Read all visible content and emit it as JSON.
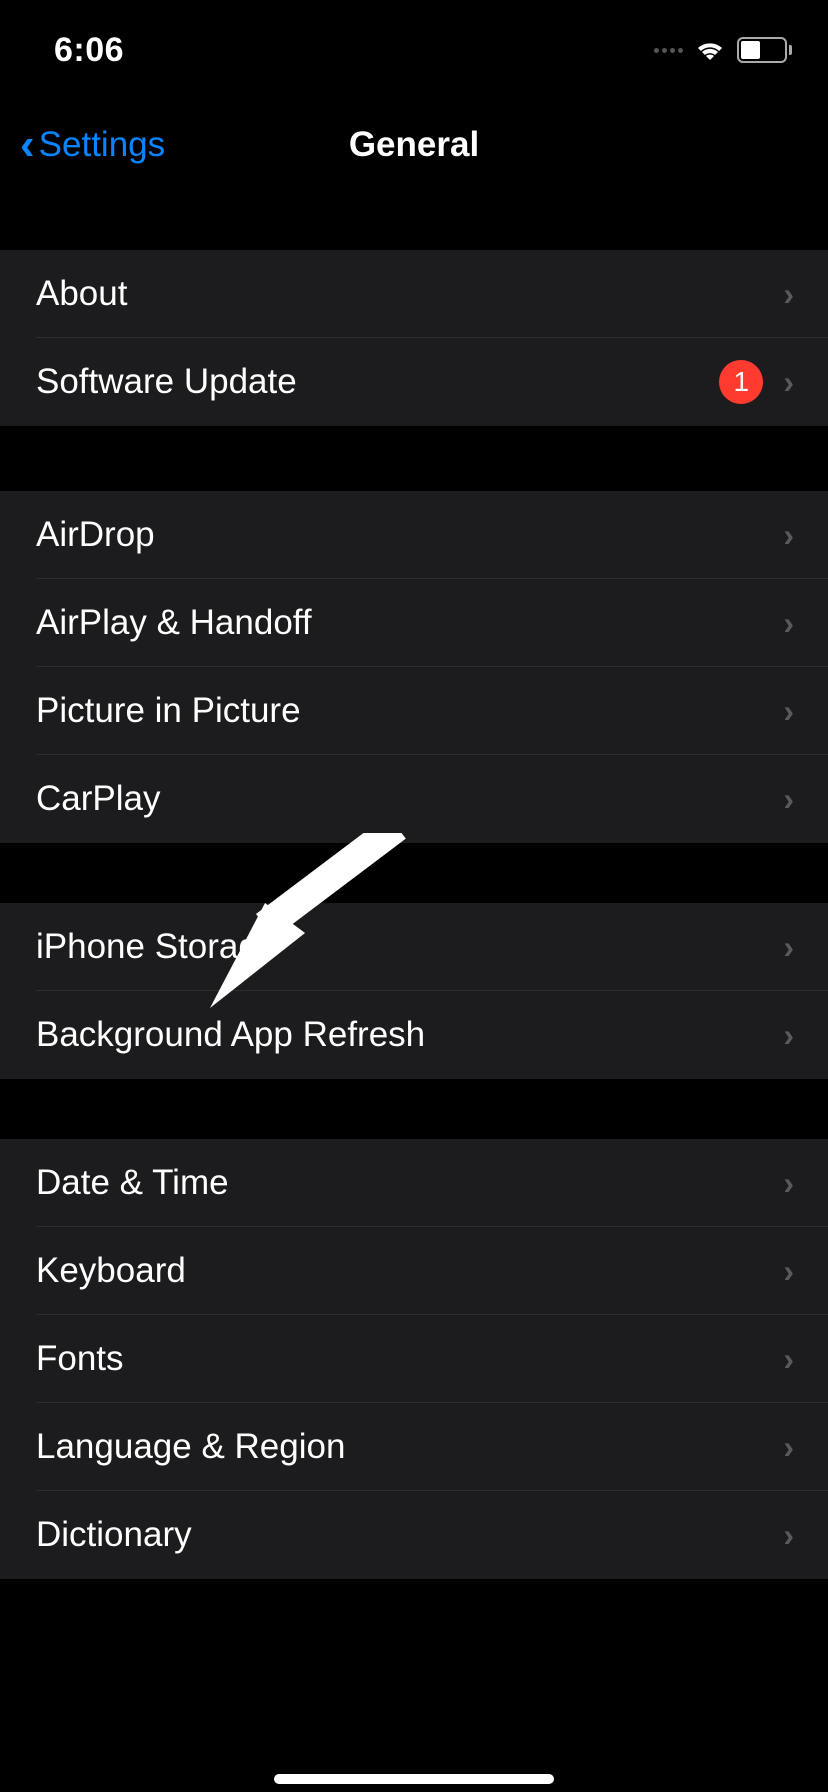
{
  "status": {
    "time": "6:06"
  },
  "nav": {
    "back": "Settings",
    "title": "General"
  },
  "sections": [
    [
      {
        "label": "About",
        "badge": null
      },
      {
        "label": "Software Update",
        "badge": "1"
      }
    ],
    [
      {
        "label": "AirDrop",
        "badge": null
      },
      {
        "label": "AirPlay & Handoff",
        "badge": null
      },
      {
        "label": "Picture in Picture",
        "badge": null
      },
      {
        "label": "CarPlay",
        "badge": null
      }
    ],
    [
      {
        "label": "iPhone Storage",
        "badge": null
      },
      {
        "label": "Background App Refresh",
        "badge": null
      }
    ],
    [
      {
        "label": "Date & Time",
        "badge": null
      },
      {
        "label": "Keyboard",
        "badge": null
      },
      {
        "label": "Fonts",
        "badge": null
      },
      {
        "label": "Language & Region",
        "badge": null
      },
      {
        "label": "Dictionary",
        "badge": null
      }
    ]
  ]
}
